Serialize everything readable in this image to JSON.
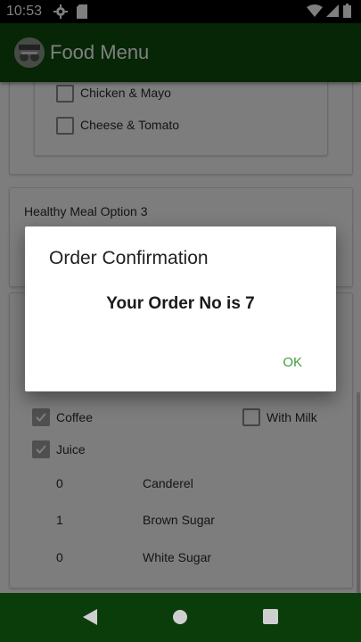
{
  "status_bar": {
    "time": "10:53"
  },
  "app_bar": {
    "title": "Food Menu"
  },
  "sandwich_options": [
    {
      "label": "Chicken & Mayo",
      "checked": false
    },
    {
      "label": "Cheese & Tomato",
      "checked": false
    }
  ],
  "healthy_meal": {
    "title": "Healthy Meal Option 3"
  },
  "drinks": [
    {
      "label": "Coffee",
      "checked": true
    },
    {
      "label": "Juice",
      "checked": true
    }
  ],
  "extras": [
    {
      "label": "With Milk",
      "checked": false
    }
  ],
  "sweeteners": [
    {
      "count": "0",
      "label": "Canderel"
    },
    {
      "count": "1",
      "label": "Brown Sugar"
    },
    {
      "count": "0",
      "label": "White Sugar"
    }
  ],
  "dialog": {
    "title": "Order Confirmation",
    "message": "Your Order No is 7",
    "ok_label": "OK"
  },
  "colors": {
    "app_bar": "#0d4d0d",
    "nav_bar": "#0b3d0b",
    "accent": "#3f9e3f"
  }
}
